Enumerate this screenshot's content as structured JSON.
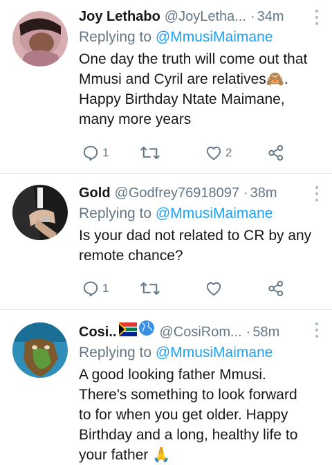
{
  "tweets": [
    {
      "name": "Joy Lethabo",
      "handle": "@JoyLetha...",
      "time": "34m",
      "reply_prefix": "Replying to ",
      "reply_to": "@MmusiMaimane",
      "lines": [
        "One day the truth will come out that",
        "Mmusi and Cyril are relatives🙈.",
        "Happy Birthday Ntate Maimane,",
        "many more years"
      ],
      "reply_count": "1",
      "retweet_count": "",
      "like_count": "2"
    },
    {
      "name": "Gold",
      "handle": "@Godfrey76918097",
      "time": "38m",
      "reply_prefix": "Replying to ",
      "reply_to": "@MmusiMaimane",
      "lines": [
        "Is your dad not related to CR by any",
        "remote chance?"
      ],
      "reply_count": "1",
      "retweet_count": "",
      "like_count": ""
    },
    {
      "name": "Cosi..",
      "handle": "@CosiRom...",
      "time": "58m",
      "reply_prefix": "Replying to ",
      "reply_to": "@MmusiMaimane",
      "lines": [
        "A good looking father Mmusi.",
        "There's something to look forward",
        "to for when you get older. Happy",
        "Birthday and a long, healthy life to",
        "your father 🙏"
      ]
    }
  ],
  "separator": "·",
  "icons": {
    "reply": "reply-icon",
    "retweet": "retweet-icon",
    "like": "heart-icon",
    "share": "share-icon",
    "more": "more-vertical-icon"
  },
  "colors": {
    "mention": "#1da1f2",
    "secondary": "#657786",
    "divider": "#e1e8ed"
  }
}
